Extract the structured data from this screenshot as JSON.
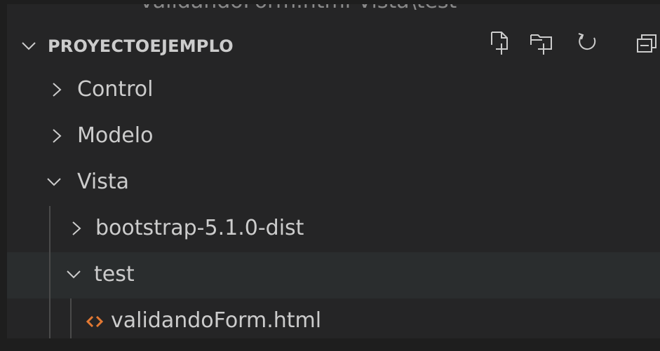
{
  "explorer": {
    "top_peek_text": "validandoForm.html  Vista\\test",
    "section_title": "PROYECTOEJEMPLO",
    "actions": [
      {
        "name": "new-file-icon"
      },
      {
        "name": "new-folder-icon"
      },
      {
        "name": "refresh-icon"
      },
      {
        "name": "collapse-all-icon"
      }
    ],
    "tree": [
      {
        "label": "Control",
        "expanded": false
      },
      {
        "label": "Modelo",
        "expanded": false
      },
      {
        "label": "Vista",
        "expanded": true
      },
      {
        "label": "bootstrap-5.1.0-dist",
        "expanded": false
      },
      {
        "label": "test",
        "expanded": true
      },
      {
        "label": "validandoForm.html",
        "type": "html-file"
      }
    ],
    "colors": {
      "background": "#252526",
      "text": "#cccccc",
      "hover": "#2a2d2e",
      "html_icon": "#e37933"
    }
  }
}
